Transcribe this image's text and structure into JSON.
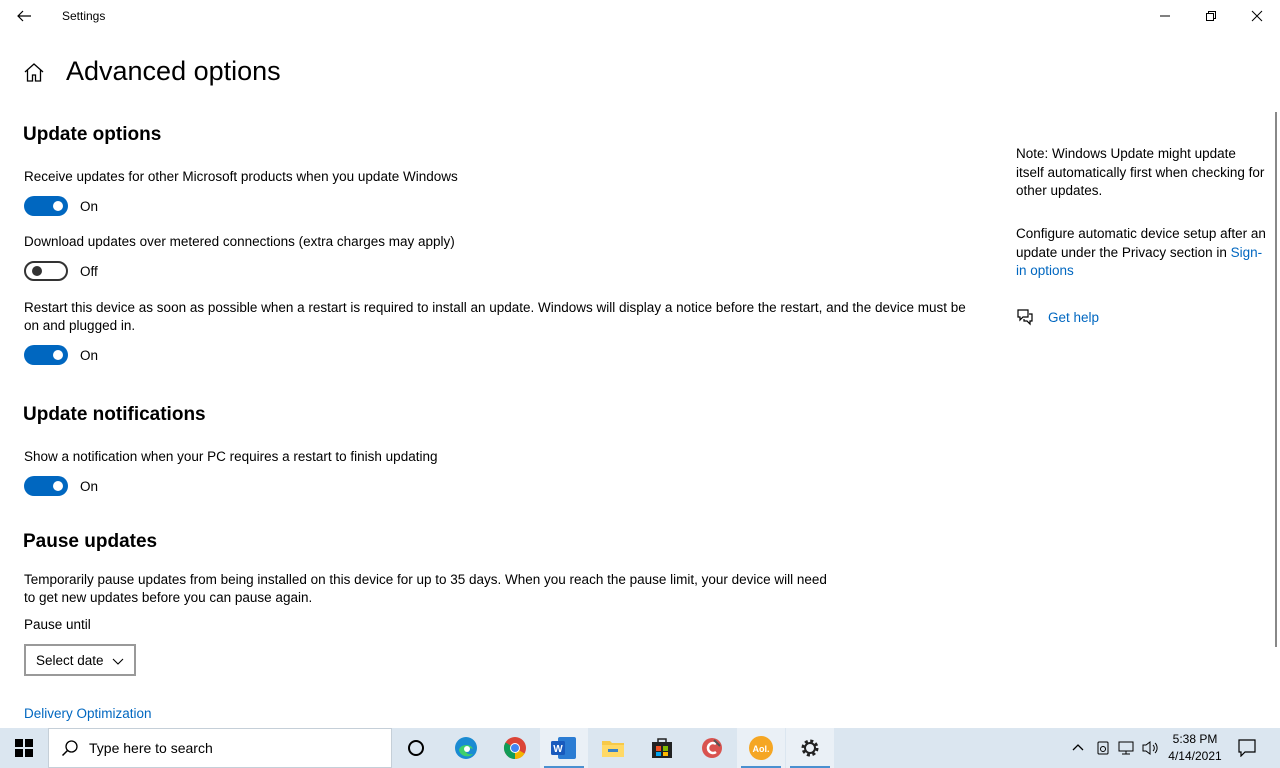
{
  "window": {
    "title": "Settings",
    "page_title": "Advanced options"
  },
  "update_options": {
    "heading": "Update options",
    "settings": [
      {
        "label": "Receive updates for other Microsoft products when you update Windows",
        "state": "On"
      },
      {
        "label": "Download updates over metered connections (extra charges may apply)",
        "state": "Off"
      },
      {
        "label": "Restart this device as soon as possible when a restart is required to install an update. Windows will display a notice before the restart, and the device must be on and plugged in.",
        "state": "On"
      }
    ]
  },
  "update_notifications": {
    "heading": "Update notifications",
    "settings": [
      {
        "label": "Show a notification when your PC requires a restart to finish updating",
        "state": "On"
      }
    ]
  },
  "pause_updates": {
    "heading": "Pause updates",
    "description": "Temporarily pause updates from being installed on this device for up to 35 days. When you reach the pause limit, your device will need to get new updates before you can pause again.",
    "pause_until_label": "Pause until",
    "select_value": "Select date"
  },
  "links": {
    "delivery_optimization": "Delivery Optimization"
  },
  "side_panel": {
    "note": "Note: Windows Update might update itself automatically first when checking for other updates.",
    "config_prefix": "Configure automatic device setup after an update under the Privacy section in ",
    "config_link": "Sign-in options",
    "help_link": "Get help"
  },
  "taskbar": {
    "search_placeholder": "Type here to search",
    "time": "5:38 PM",
    "date": "4/14/2021",
    "apps": [
      "cortana-icon",
      "edge-icon",
      "chrome-icon",
      "word-icon",
      "file-explorer-icon",
      "store-icon",
      "ccleaner-icon",
      "aol-icon",
      "settings-icon"
    ]
  },
  "colors": {
    "accent": "#0067c0",
    "taskbar": "#dbe6f0"
  }
}
